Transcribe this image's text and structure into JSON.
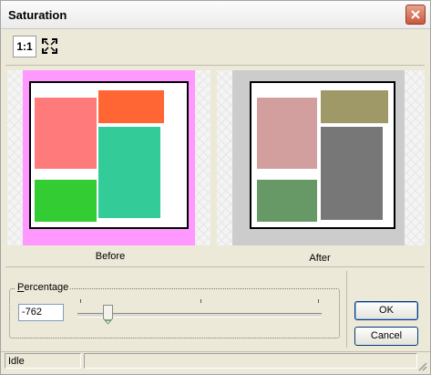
{
  "window": {
    "title": "Saturation"
  },
  "toolbar": {
    "actual_size_label": "1:1"
  },
  "previews": {
    "before": {
      "caption": "Before",
      "frame_color": "#ff99ff",
      "colors": [
        "#ff7b7b",
        "#ff6633",
        "#33cc33",
        "#33cc99"
      ]
    },
    "after": {
      "caption": "After",
      "frame_color": "#cccccc",
      "colors": [
        "#d29e9e",
        "#9e9966",
        "#669966",
        "#777777"
      ]
    }
  },
  "percentage": {
    "label": "Percentage",
    "value": "-762"
  },
  "buttons": {
    "ok": "OK",
    "cancel": "Cancel"
  },
  "status": {
    "text": "Idle"
  }
}
